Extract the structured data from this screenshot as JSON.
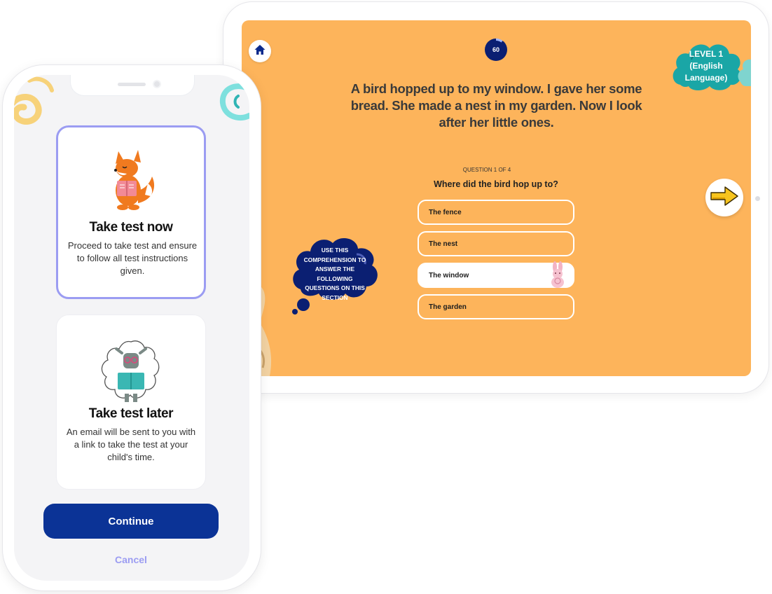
{
  "tablet": {
    "timer_value": "60",
    "level_label": "LEVEL 1\n(English\nLanguage)",
    "passage": "A bird hopped up to my window. I gave her some bread. She made a nest in my garden. Now I look after her little ones.",
    "question_counter": "QUESTION 1 OF 4",
    "question": "Where did the bird hop up to?",
    "answers": [
      {
        "label": "The fence",
        "selected": false
      },
      {
        "label": "The nest",
        "selected": false
      },
      {
        "label": "The window",
        "selected": true
      },
      {
        "label": "The garden",
        "selected": false
      }
    ],
    "hint_cloud": "USE THIS\nCOMPREHENSION TO\nANSWER THE\nFOLLOWING\nQUESTIONS ON THIS\nSECTION",
    "colors": {
      "background": "#fdb45b",
      "cloud_navy": "#0b1f72",
      "level_teal": "#1aa6a6",
      "arrow_yellow": "#f7c41d"
    },
    "icons": {
      "home": "home-icon",
      "next": "arrow-right-icon"
    }
  },
  "phone": {
    "options": [
      {
        "title": "Take test now",
        "description": "Proceed to take test and ensure to follow all test instructions given.",
        "selected": true,
        "illustration": "fox-reading-icon"
      },
      {
        "title": "Take test later",
        "description": "An email will be sent to you with a link to take the test at your child's time.",
        "selected": false,
        "illustration": "sheep-reading-icon"
      }
    ],
    "continue_label": "Continue",
    "cancel_label": "Cancel",
    "colors": {
      "primary": "#0b3396",
      "accent": "#9b9cf2"
    }
  }
}
